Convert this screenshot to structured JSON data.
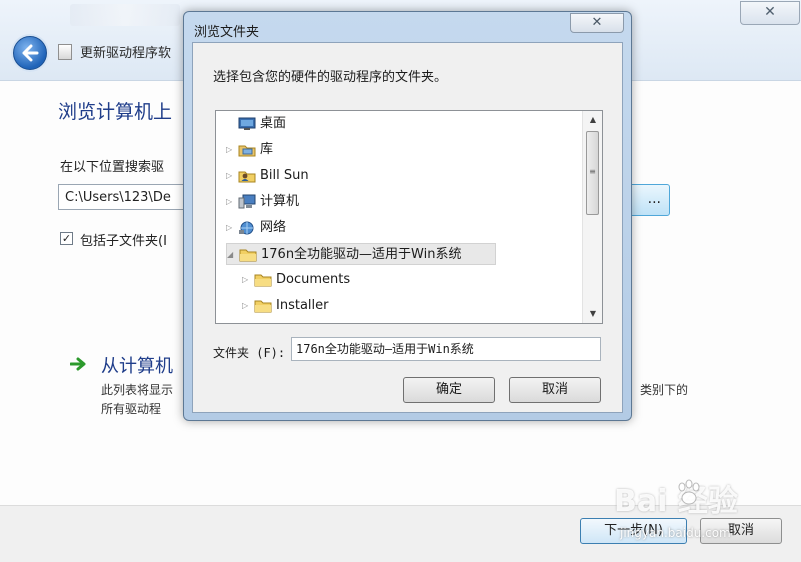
{
  "background_window": {
    "title": "更新驱动程序软",
    "heading": "浏览计算机上",
    "search_label": "在以下位置搜索驱",
    "path_value": "C:\\Users\\123\\De",
    "browse_label": "...",
    "include_subfolders_label": "包括子文件夹(I",
    "include_subfolders_checked": true,
    "option_title": "从计算机",
    "option_desc_line1": "此列表将显示",
    "option_desc_line2": "所有驱动程",
    "option_desc_right": "类别下的",
    "next_button": "下一步(N)",
    "cancel_button": "取消"
  },
  "dialog": {
    "title": "浏览文件夹",
    "instruction": "选择包含您的硬件的驱动程序的文件夹。",
    "tree": [
      {
        "label": "桌面",
        "icon": "desktop-icon",
        "level": 0,
        "expander": ""
      },
      {
        "label": "库",
        "icon": "library-icon",
        "level": 0,
        "expander": "▷"
      },
      {
        "label": "Bill Sun",
        "icon": "user-folder-icon",
        "level": 0,
        "expander": "▷"
      },
      {
        "label": "计算机",
        "icon": "computer-icon",
        "level": 0,
        "expander": "▷"
      },
      {
        "label": "网络",
        "icon": "network-icon",
        "level": 0,
        "expander": "▷"
      },
      {
        "label": "176n全功能驱动—适用于Win系统",
        "icon": "folder-icon",
        "level": 0,
        "expander": "◢",
        "selected": true
      },
      {
        "label": "Documents",
        "icon": "folder-icon",
        "level": 1,
        "expander": "▷"
      },
      {
        "label": "Installer",
        "icon": "folder-icon",
        "level": 1,
        "expander": "▷"
      }
    ],
    "folder_label": "文件夹 (F):",
    "folder_value": "176n全功能驱动—适用于Win系统",
    "ok_button": "确定",
    "cancel_button": "取消",
    "close_glyph": "✕"
  },
  "watermark": {
    "brand": "Bai  经验",
    "url": "jingyan.baidu.com"
  },
  "colors": {
    "heading_blue": "#1f3d8a",
    "dialog_frame": "#b3cbe5",
    "selection": "#e8e8e8"
  }
}
